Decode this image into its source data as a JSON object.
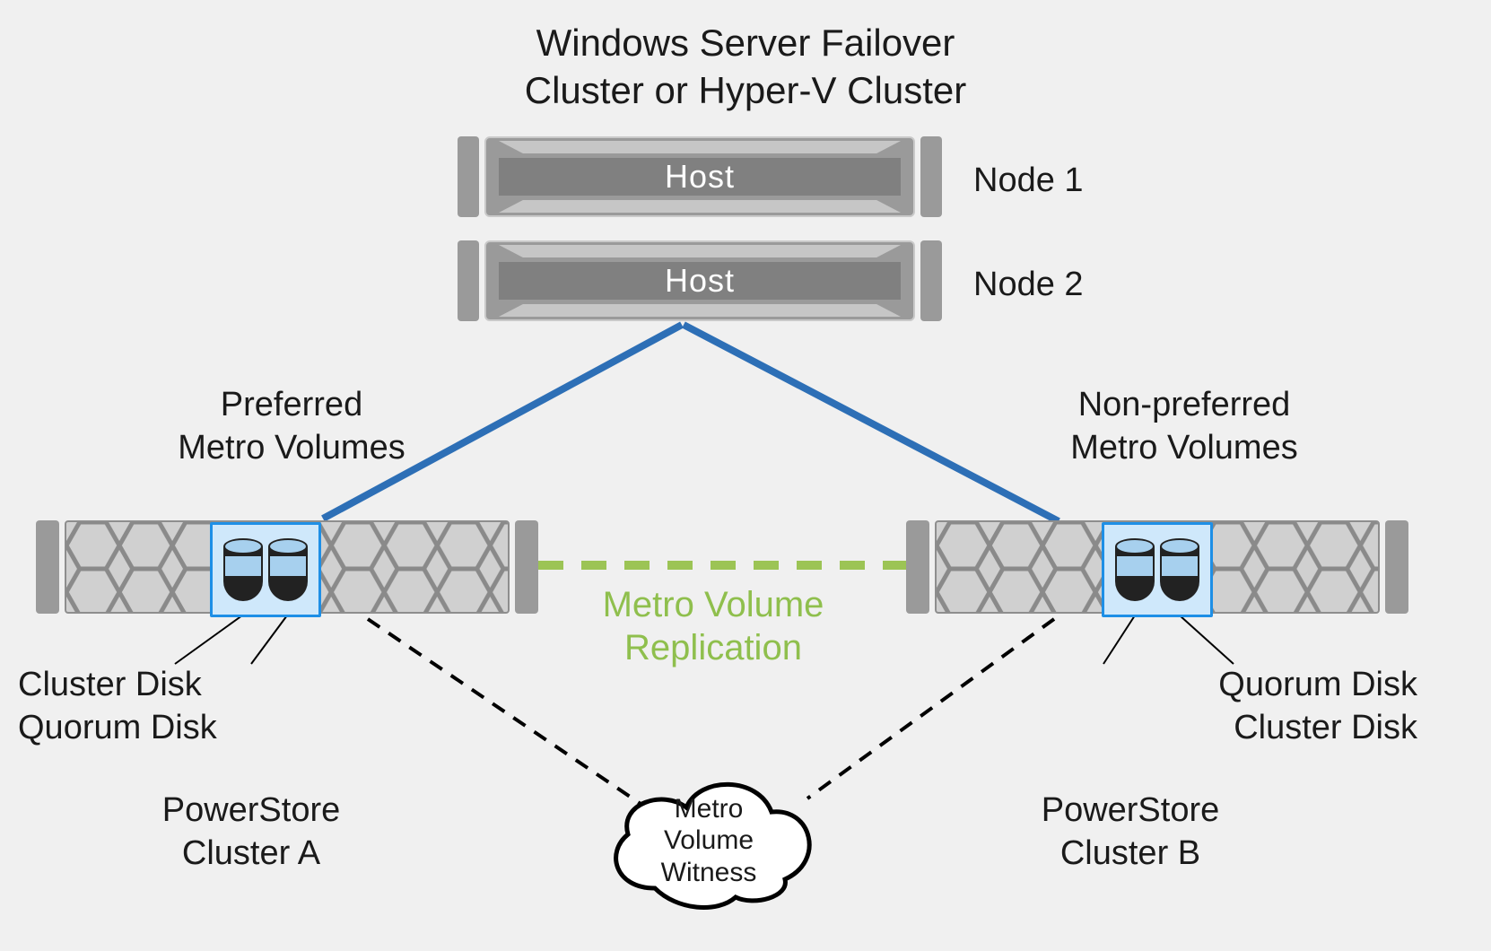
{
  "title_line1": "Windows Server Failover",
  "title_line2": "Cluster or Hyper-V Cluster",
  "host_label": "Host",
  "node1_label": "Node 1",
  "node2_label": "Node 2",
  "preferred_line1": "Preferred",
  "preferred_line2": "Metro Volumes",
  "nonpreferred_line1": "Non-preferred",
  "nonpreferred_line2": "Metro Volumes",
  "replication_line1": "Metro Volume",
  "replication_line2": "Replication",
  "clusterA_disk1": "Cluster Disk",
  "clusterA_disk2": "Quorum Disk",
  "clusterB_disk1": "Quorum Disk",
  "clusterB_disk2": "Cluster Disk",
  "clusterA_name_line1": "PowerStore",
  "clusterA_name_line2": "Cluster A",
  "clusterB_name_line1": "PowerStore",
  "clusterB_name_line2": "Cluster B",
  "witness_line1": "Metro",
  "witness_line2": "Volume",
  "witness_line3": "Witness",
  "colors": {
    "connection_blue": "#2d6fb6",
    "replication_green": "#9cc455",
    "witness_dash": "#000000"
  }
}
